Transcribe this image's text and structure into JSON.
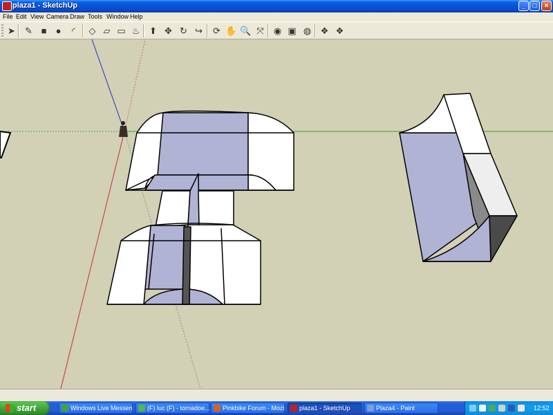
{
  "window": {
    "title": "plaza1 - SketchUp"
  },
  "menu": [
    "File",
    "Edit",
    "View",
    "Camera",
    "Draw",
    "Tools",
    "Window",
    "Help"
  ],
  "toolbar": {
    "tools": [
      {
        "name": "select-tool-icon",
        "glyph": "➤"
      },
      {
        "name": "pencil-tool-icon",
        "glyph": "✎"
      },
      {
        "name": "rectangle-tool-icon",
        "glyph": "■"
      },
      {
        "name": "circle-tool-icon",
        "glyph": "●"
      },
      {
        "name": "arc-tool-icon",
        "glyph": "◜"
      },
      {
        "name": "make-component-icon",
        "glyph": "◇"
      },
      {
        "name": "eraser-tool-icon",
        "glyph": "▱"
      },
      {
        "name": "tape-measure-icon",
        "glyph": "▭"
      },
      {
        "name": "paint-bucket-icon",
        "glyph": "♨"
      },
      {
        "name": "push-pull-icon",
        "glyph": "⬆"
      },
      {
        "name": "move-tool-icon",
        "glyph": "✥"
      },
      {
        "name": "rotate-tool-icon",
        "glyph": "↻"
      },
      {
        "name": "offset-tool-icon",
        "glyph": "↪"
      },
      {
        "name": "orbit-tool-icon",
        "glyph": "⟳"
      },
      {
        "name": "pan-tool-icon",
        "glyph": "✋"
      },
      {
        "name": "zoom-tool-icon",
        "glyph": "🔍"
      },
      {
        "name": "zoom-extents-icon",
        "glyph": "⤧"
      },
      {
        "name": "get-models-icon",
        "glyph": "◉"
      },
      {
        "name": "share-model-icon",
        "glyph": "▣"
      },
      {
        "name": "google-earth-icon",
        "glyph": "◍"
      },
      {
        "name": "get-components-icon",
        "glyph": "❖"
      },
      {
        "name": "share-component-icon",
        "glyph": "❖"
      }
    ]
  },
  "taskbar": {
    "start_label": "start",
    "tasks": [
      {
        "label": "Windows Live Messen...",
        "icon_color": "#3fa43a",
        "active": false
      },
      {
        "label": "(F) luc (F) - tornadoe...",
        "icon_color": "#4fb84a",
        "active": false
      },
      {
        "label": "Pinkbike Forum - Mozil...",
        "icon_color": "#d8621c",
        "active": false
      },
      {
        "label": "plaza1 - SketchUp",
        "icon_color": "#c02020",
        "active": true
      },
      {
        "label": "Plaza4 - Paint",
        "icon_color": "#7aa0d8",
        "active": false
      }
    ],
    "clock": "12:52"
  },
  "colors": {
    "viewport_bg": "#d2d0b5",
    "face_blue": "#b1b3d5",
    "face_white": "#ffffff",
    "face_dark": "#4a4a4a"
  }
}
